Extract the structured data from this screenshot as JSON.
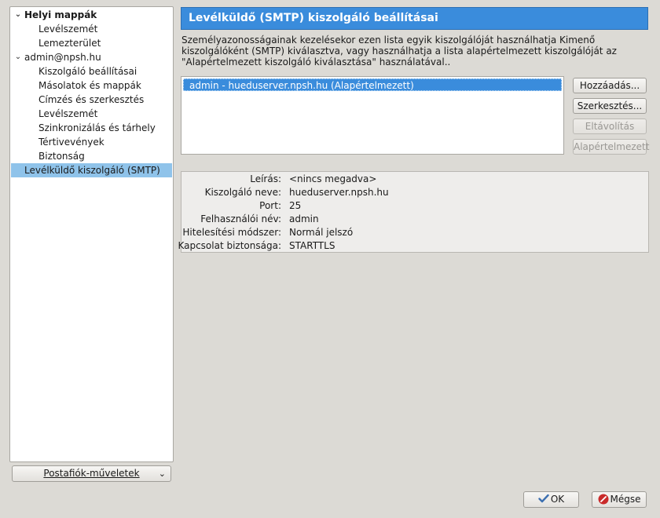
{
  "sidebar": {
    "items": [
      {
        "label": "Helyi mappák",
        "level": 0,
        "bold": true,
        "expanded": true
      },
      {
        "label": "Levélszemét",
        "level": 1
      },
      {
        "label": "Lemezterület",
        "level": 1
      },
      {
        "label": "admin@npsh.hu",
        "level": 0,
        "expanded": true
      },
      {
        "label": "Kiszolgáló beállításai",
        "level": 1
      },
      {
        "label": "Másolatok és mappák",
        "level": 1
      },
      {
        "label": "Címzés és szerkesztés",
        "level": 1
      },
      {
        "label": "Levélszemét",
        "level": 1
      },
      {
        "label": "Szinkronizálás és tárhely",
        "level": 1
      },
      {
        "label": "Tértivevények",
        "level": 1
      },
      {
        "label": "Biztonság",
        "level": 1
      },
      {
        "label": "Levélküldő kiszolgáló (SMTP)",
        "level": 0,
        "selected": true
      }
    ],
    "account_actions_label": "Postafiók-műveletek"
  },
  "panel": {
    "title": "Levélküldő (SMTP) kiszolgáló beállításai",
    "description": "Személyazonosságainak kezelésekor ezen lista egyik kiszolgálóját használhatja Kimenő kiszolgálóként (SMTP) kiválasztva, vagy használhatja a lista alapértelmezett kiszolgálóját az \"Alapértelmezett kiszolgáló kiválasztása\" használatával..",
    "servers": [
      {
        "label": "admin - hueduserver.npsh.hu (Alapértelmezett)",
        "selected": true
      }
    ],
    "buttons": {
      "add": "Hozzáadás...",
      "edit": "Szerkesztés...",
      "remove": "Eltávolítás",
      "set_default": "Alapértelmezett"
    }
  },
  "details": [
    {
      "label": "Leírás:",
      "value": "<nincs megadva>"
    },
    {
      "label": "Kiszolgáló neve:",
      "value": "hueduserver.npsh.hu"
    },
    {
      "label": "Port:",
      "value": "25"
    },
    {
      "label": "Felhasználói név:",
      "value": "admin"
    },
    {
      "label": "Hitelesítési módszer:",
      "value": "Normál jelszó"
    },
    {
      "label": "Kapcsolat biztonsága:",
      "value": "STARTTLS"
    }
  ],
  "dialog": {
    "ok_label": "OK",
    "cancel_label": "Mégse"
  },
  "colors": {
    "accent": "#3a8cdc",
    "selection": "#8fc3ea",
    "window_bg": "#dcdad5",
    "cancel_icon": "#c92a2a",
    "ok_icon": "#3c6fb0"
  }
}
